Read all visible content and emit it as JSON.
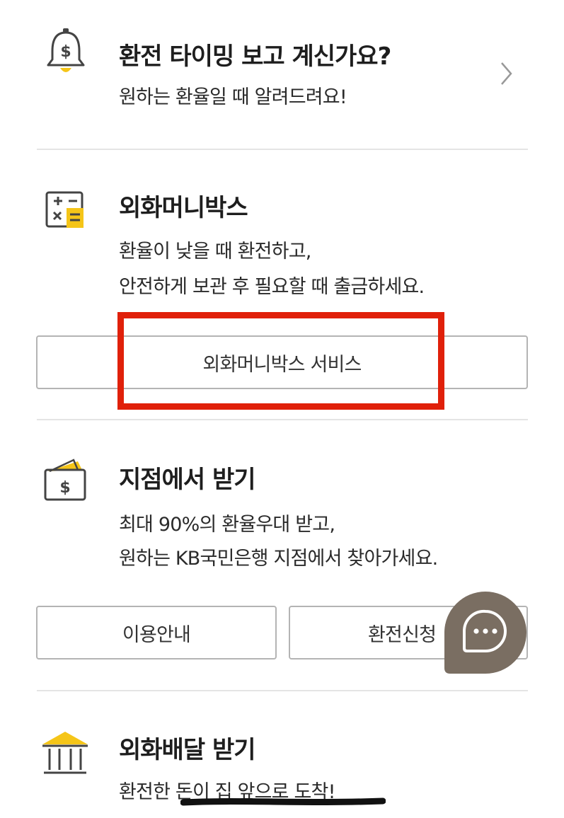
{
  "alert": {
    "title": "환전 타이밍 보고 계신가요?",
    "desc": "원하는 환율일 때 알려드려요!",
    "icon": "bell-dollar-icon"
  },
  "moneybox": {
    "title": "외화머니박스",
    "desc_line1": "환율이 낮을 때 환전하고,",
    "desc_line2": "안전하게 보관 후 필요할 때 출금하세요.",
    "button_label": "외화머니박스 서비스",
    "icon": "calculator-icon"
  },
  "branch": {
    "title": "지점에서 받기",
    "desc_line1": "최대 90%의 환율우대 받고,",
    "desc_line2": "원하는 KB국민은행 지점에서 찾아가세요.",
    "guide_button": "이용안내",
    "apply_button": "환전신청",
    "icon": "wallet-dollar-icon"
  },
  "delivery": {
    "title": "외화배달 받기",
    "desc_line1": "환전한 돈이 집 앞으로 도착!",
    "icon": "bank-building-icon"
  },
  "colors": {
    "accent_yellow": "#f5c518",
    "highlight_red": "#e0200a",
    "fab_background": "#7a6e62"
  }
}
